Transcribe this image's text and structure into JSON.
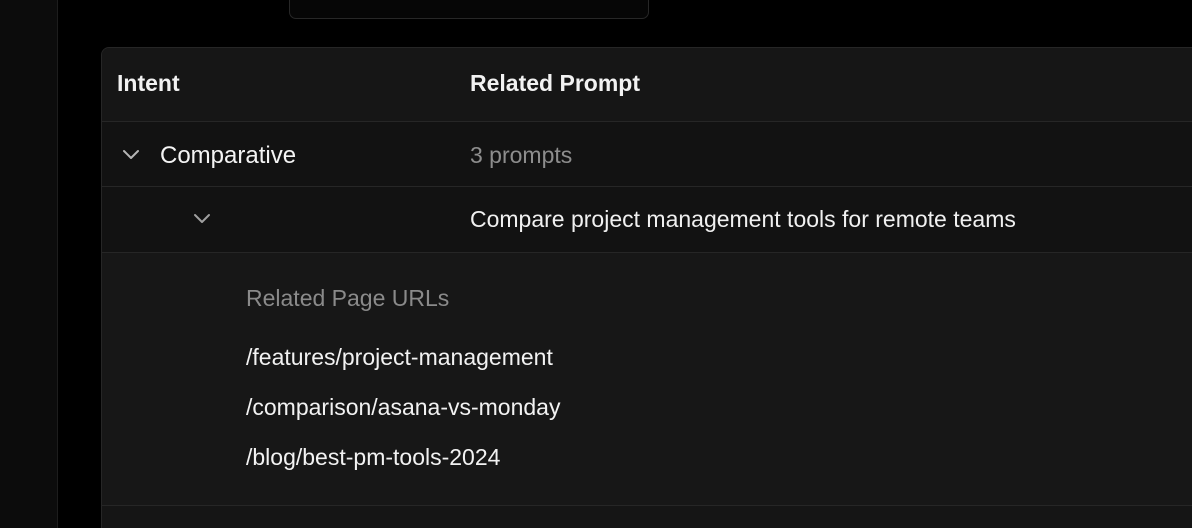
{
  "table": {
    "columns": {
      "intent": "Intent",
      "related_prompt": "Related Prompt"
    },
    "group": {
      "label": "Comparative",
      "count_text": "3 prompts",
      "expanded": true
    },
    "prompt": {
      "text": "Compare project management tools for remote teams",
      "expanded": true
    },
    "details": {
      "heading": "Related Page URLs",
      "urls": [
        "/features/project-management",
        "/comparison/asana-vs-monday",
        "/blog/best-pm-tools-2024"
      ]
    }
  },
  "icons": {
    "group_toggle": "chevron-down-icon",
    "prompt_toggle": "chevron-down-icon"
  },
  "colors": {
    "background": "#000000",
    "table_surface": "#151515",
    "border": "#262626",
    "text_primary": "#f2f2f2",
    "text_muted": "#8d8d8d"
  }
}
